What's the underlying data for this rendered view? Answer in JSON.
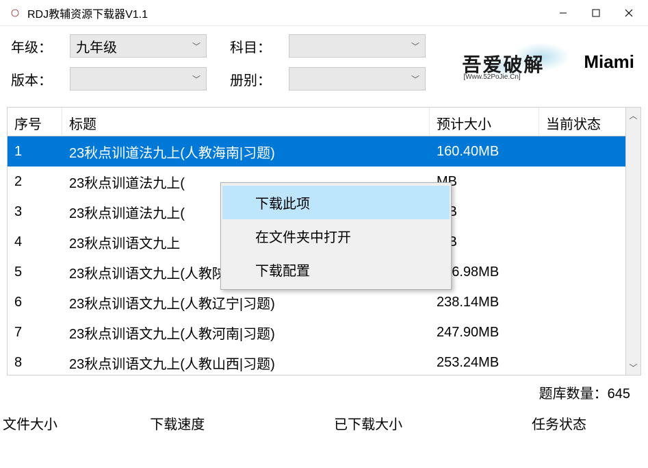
{
  "titlebar": {
    "title": "RDJ教辅资源下载器V1.1"
  },
  "toolbar": {
    "grade_label": "年级：",
    "grade_value": "九年级",
    "subject_label": "科目：",
    "subject_value": "",
    "version_label": "版本：",
    "version_value": "",
    "volume_label": "册别：",
    "volume_value": "",
    "logo_main": "吾爱破解",
    "logo_sub": "[Www.52PoJie.Cn]",
    "logo_side": "Miami"
  },
  "table": {
    "headers": {
      "seq": "序号",
      "title": "标题",
      "size": "预计大小",
      "status": "当前状态"
    },
    "rows": [
      {
        "seq": "1",
        "title": "23秋点训道法九上(人教海南|习题)",
        "size": "160.40MB",
        "status": ""
      },
      {
        "seq": "2",
        "title": "23秋点训道法九上(",
        "size": "MB",
        "status": ""
      },
      {
        "seq": "3",
        "title": "23秋点训道法九上(",
        "size": "MB",
        "status": ""
      },
      {
        "seq": "4",
        "title": "23秋点训语文九上",
        "size": "MB",
        "status": ""
      },
      {
        "seq": "5",
        "title": "23秋点训语文九上(人教陕西|习题)",
        "size": "266.98MB",
        "status": ""
      },
      {
        "seq": "6",
        "title": "23秋点训语文九上(人教辽宁|习题)",
        "size": "238.14MB",
        "status": ""
      },
      {
        "seq": "7",
        "title": "23秋点训语文九上(人教河南|习题)",
        "size": "247.90MB",
        "status": ""
      },
      {
        "seq": "8",
        "title": "23秋点训语文九上(人教山西|习题)",
        "size": "253.24MB",
        "status": ""
      }
    ]
  },
  "context_menu": {
    "items": [
      {
        "label": "下载此项",
        "hover": true
      },
      {
        "label": "在文件夹中打开",
        "hover": false
      },
      {
        "label": "下载配置",
        "hover": false
      }
    ]
  },
  "counter": {
    "label": "题库数量：",
    "value": "645"
  },
  "statusbar": {
    "filesize": "文件大小",
    "speed": "下载速度",
    "downloaded": "已下载大小",
    "task": "任务状态"
  }
}
